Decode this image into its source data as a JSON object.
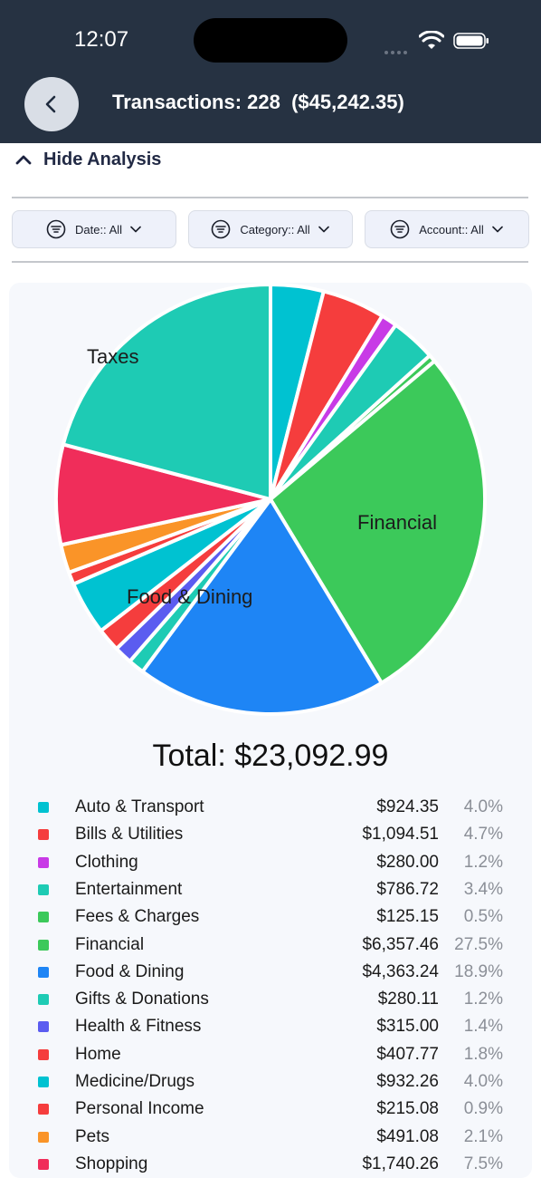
{
  "status_bar": {
    "time": "12:07"
  },
  "header": {
    "title": "Transactions: 228  ($45,242.35)"
  },
  "analysis_toggle": {
    "label": "Hide Analysis"
  },
  "filters": [
    {
      "label": "Date:: All"
    },
    {
      "label": "Category:: All"
    },
    {
      "label": "Account:: All"
    }
  ],
  "pie_labels": {
    "taxes": "Taxes",
    "financial": "Financial",
    "food": "Food & Dining"
  },
  "total": "Total: $23,092.99",
  "chart_data": {
    "type": "pie",
    "slices": [
      {
        "label": "Auto & Transport",
        "amount": "$924.35",
        "value": 924.35,
        "percent": "4.0%",
        "color": "#00c2d1"
      },
      {
        "label": "Bills & Utilities",
        "amount": "$1,094.51",
        "value": 1094.51,
        "percent": "4.7%",
        "color": "#f53d3d"
      },
      {
        "label": "Clothing",
        "amount": "$280.00",
        "value": 280.0,
        "percent": "1.2%",
        "color": "#c83ae6"
      },
      {
        "label": "Entertainment",
        "amount": "$786.72",
        "value": 786.72,
        "percent": "3.4%",
        "color": "#1ecbb4"
      },
      {
        "label": "Fees & Charges",
        "amount": "$125.15",
        "value": 125.15,
        "percent": "0.5%",
        "color": "#3cc95a"
      },
      {
        "label": "Financial",
        "amount": "$6,357.46",
        "value": 6357.46,
        "percent": "27.5%",
        "color": "#3cc95a"
      },
      {
        "label": "Food & Dining",
        "amount": "$4,363.24",
        "value": 4363.24,
        "percent": "18.9%",
        "color": "#1e85f5"
      },
      {
        "label": "Gifts & Donations",
        "amount": "$280.11",
        "value": 280.11,
        "percent": "1.2%",
        "color": "#1ecbb4"
      },
      {
        "label": "Health & Fitness",
        "amount": "$315.00",
        "value": 315.0,
        "percent": "1.4%",
        "color": "#5b5cf0"
      },
      {
        "label": "Home",
        "amount": "$407.77",
        "value": 407.77,
        "percent": "1.8%",
        "color": "#f53d3d"
      },
      {
        "label": "Medicine/Drugs",
        "amount": "$932.26",
        "value": 932.26,
        "percent": "4.0%",
        "color": "#00c2d1"
      },
      {
        "label": "Personal Income",
        "amount": "$215.08",
        "value": 215.08,
        "percent": "0.9%",
        "color": "#f53d3d"
      },
      {
        "label": "Pets",
        "amount": "$491.08",
        "value": 491.08,
        "percent": "2.1%",
        "color": "#fa9428"
      },
      {
        "label": "Shopping",
        "amount": "$1,740.26",
        "value": 1740.26,
        "percent": "7.5%",
        "color": "#f02d5a"
      },
      {
        "label": "Taxes",
        "amount": "",
        "value": 4836.0,
        "percent": "",
        "color": "#1ecbb4"
      }
    ]
  }
}
